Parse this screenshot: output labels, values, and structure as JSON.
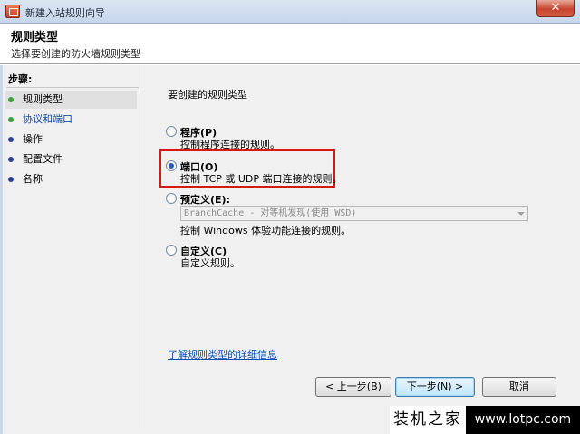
{
  "window": {
    "title": "新建入站规则向导",
    "close_glyph": "✕"
  },
  "header": {
    "heading": "规则类型",
    "subheading": "选择要创建的防火墙规则类型"
  },
  "steps": {
    "label": "步骤:",
    "items": [
      {
        "label": "规则类型",
        "state": "done"
      },
      {
        "label": "协议和端口",
        "state": "done"
      },
      {
        "label": "操作",
        "state": "todo"
      },
      {
        "label": "配置文件",
        "state": "todo"
      },
      {
        "label": "名称",
        "state": "todo"
      }
    ]
  },
  "main": {
    "question": "要创建的规则类型",
    "options": [
      {
        "label": "程序(P)",
        "desc": "控制程序连接的规则。",
        "checked": false
      },
      {
        "label": "端口(O)",
        "desc": "控制 TCP 或 UDP 端口连接的规则。",
        "checked": true
      },
      {
        "label": "预定义(E):",
        "combo": "BranchCache - 对等机发现(使用 WSD)",
        "desc": "控制 Windows 体验功能连接的规则。",
        "checked": false
      },
      {
        "label": "自定义(C)",
        "desc": "自定义规则。",
        "checked": false
      }
    ],
    "learn_link": "了解规则类型的详细信息"
  },
  "buttons": {
    "back": "< 上一步(B)",
    "next": "下一步(N) >",
    "cancel": "取消"
  },
  "watermark": {
    "left": "装机之家",
    "right": "www.lotpc.com"
  },
  "colors": {
    "highlight_box": "#d21a1a",
    "link": "#0b4fb0",
    "step_done": "#3aa23a",
    "step_todo": "#2b3f9a"
  }
}
